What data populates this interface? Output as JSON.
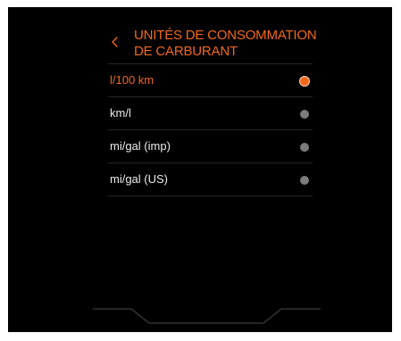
{
  "header": {
    "back_icon": "chevron-left-icon",
    "title": "UNITÉS DE CONSOMMATION DE CARBURANT"
  },
  "options": [
    {
      "label": "l/100 km",
      "selected": true
    },
    {
      "label": "km/l",
      "selected": false
    },
    {
      "label": "mi/gal (imp)",
      "selected": false
    },
    {
      "label": "mi/gal (US)",
      "selected": false
    }
  ],
  "colors": {
    "accent": "#f2681c",
    "background": "#000000",
    "text": "#ececec",
    "radio_inactive": "#7c7c7c"
  }
}
